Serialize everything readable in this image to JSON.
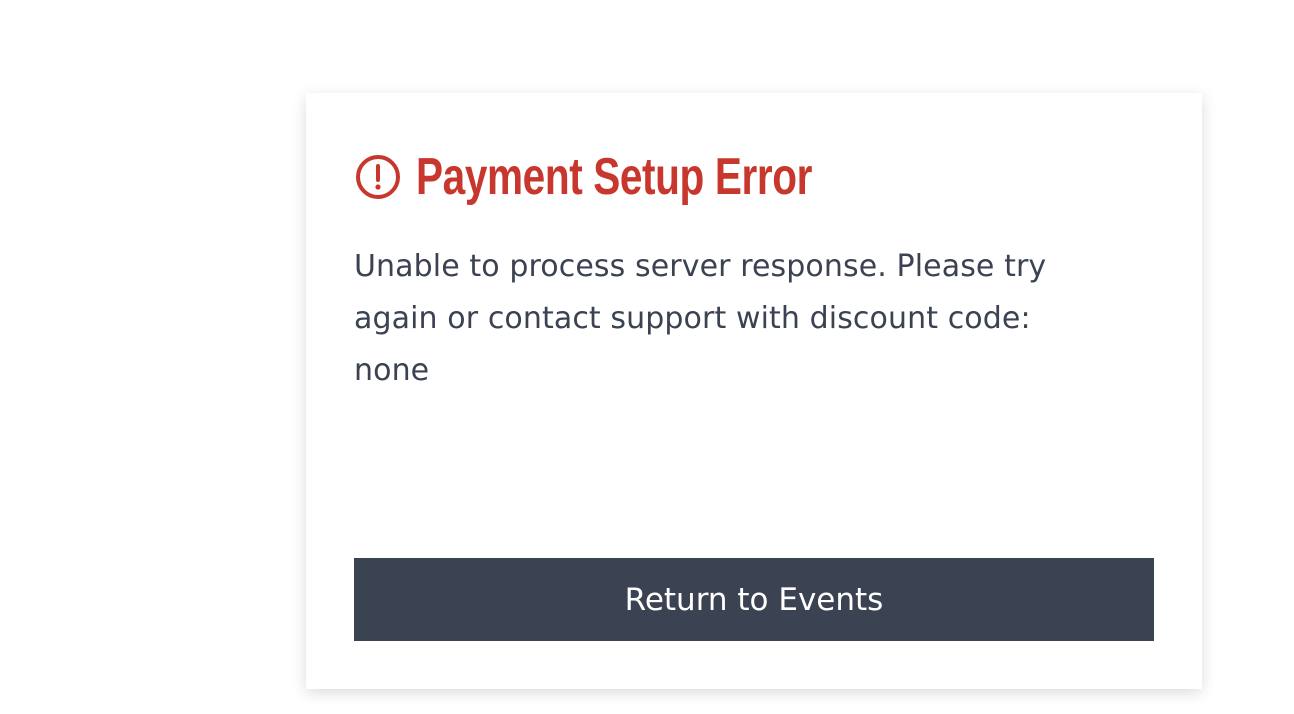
{
  "error": {
    "icon": "alert-circle-icon",
    "title": "Payment Setup Error",
    "message": "Unable to process server response. Please try again or contact support with discount code: none"
  },
  "actions": {
    "return_label": "Return to Events"
  },
  "colors": {
    "error_red": "#c8372d",
    "text_dark": "#3b4252",
    "button_bg": "#3b4252",
    "button_text": "#ffffff"
  }
}
